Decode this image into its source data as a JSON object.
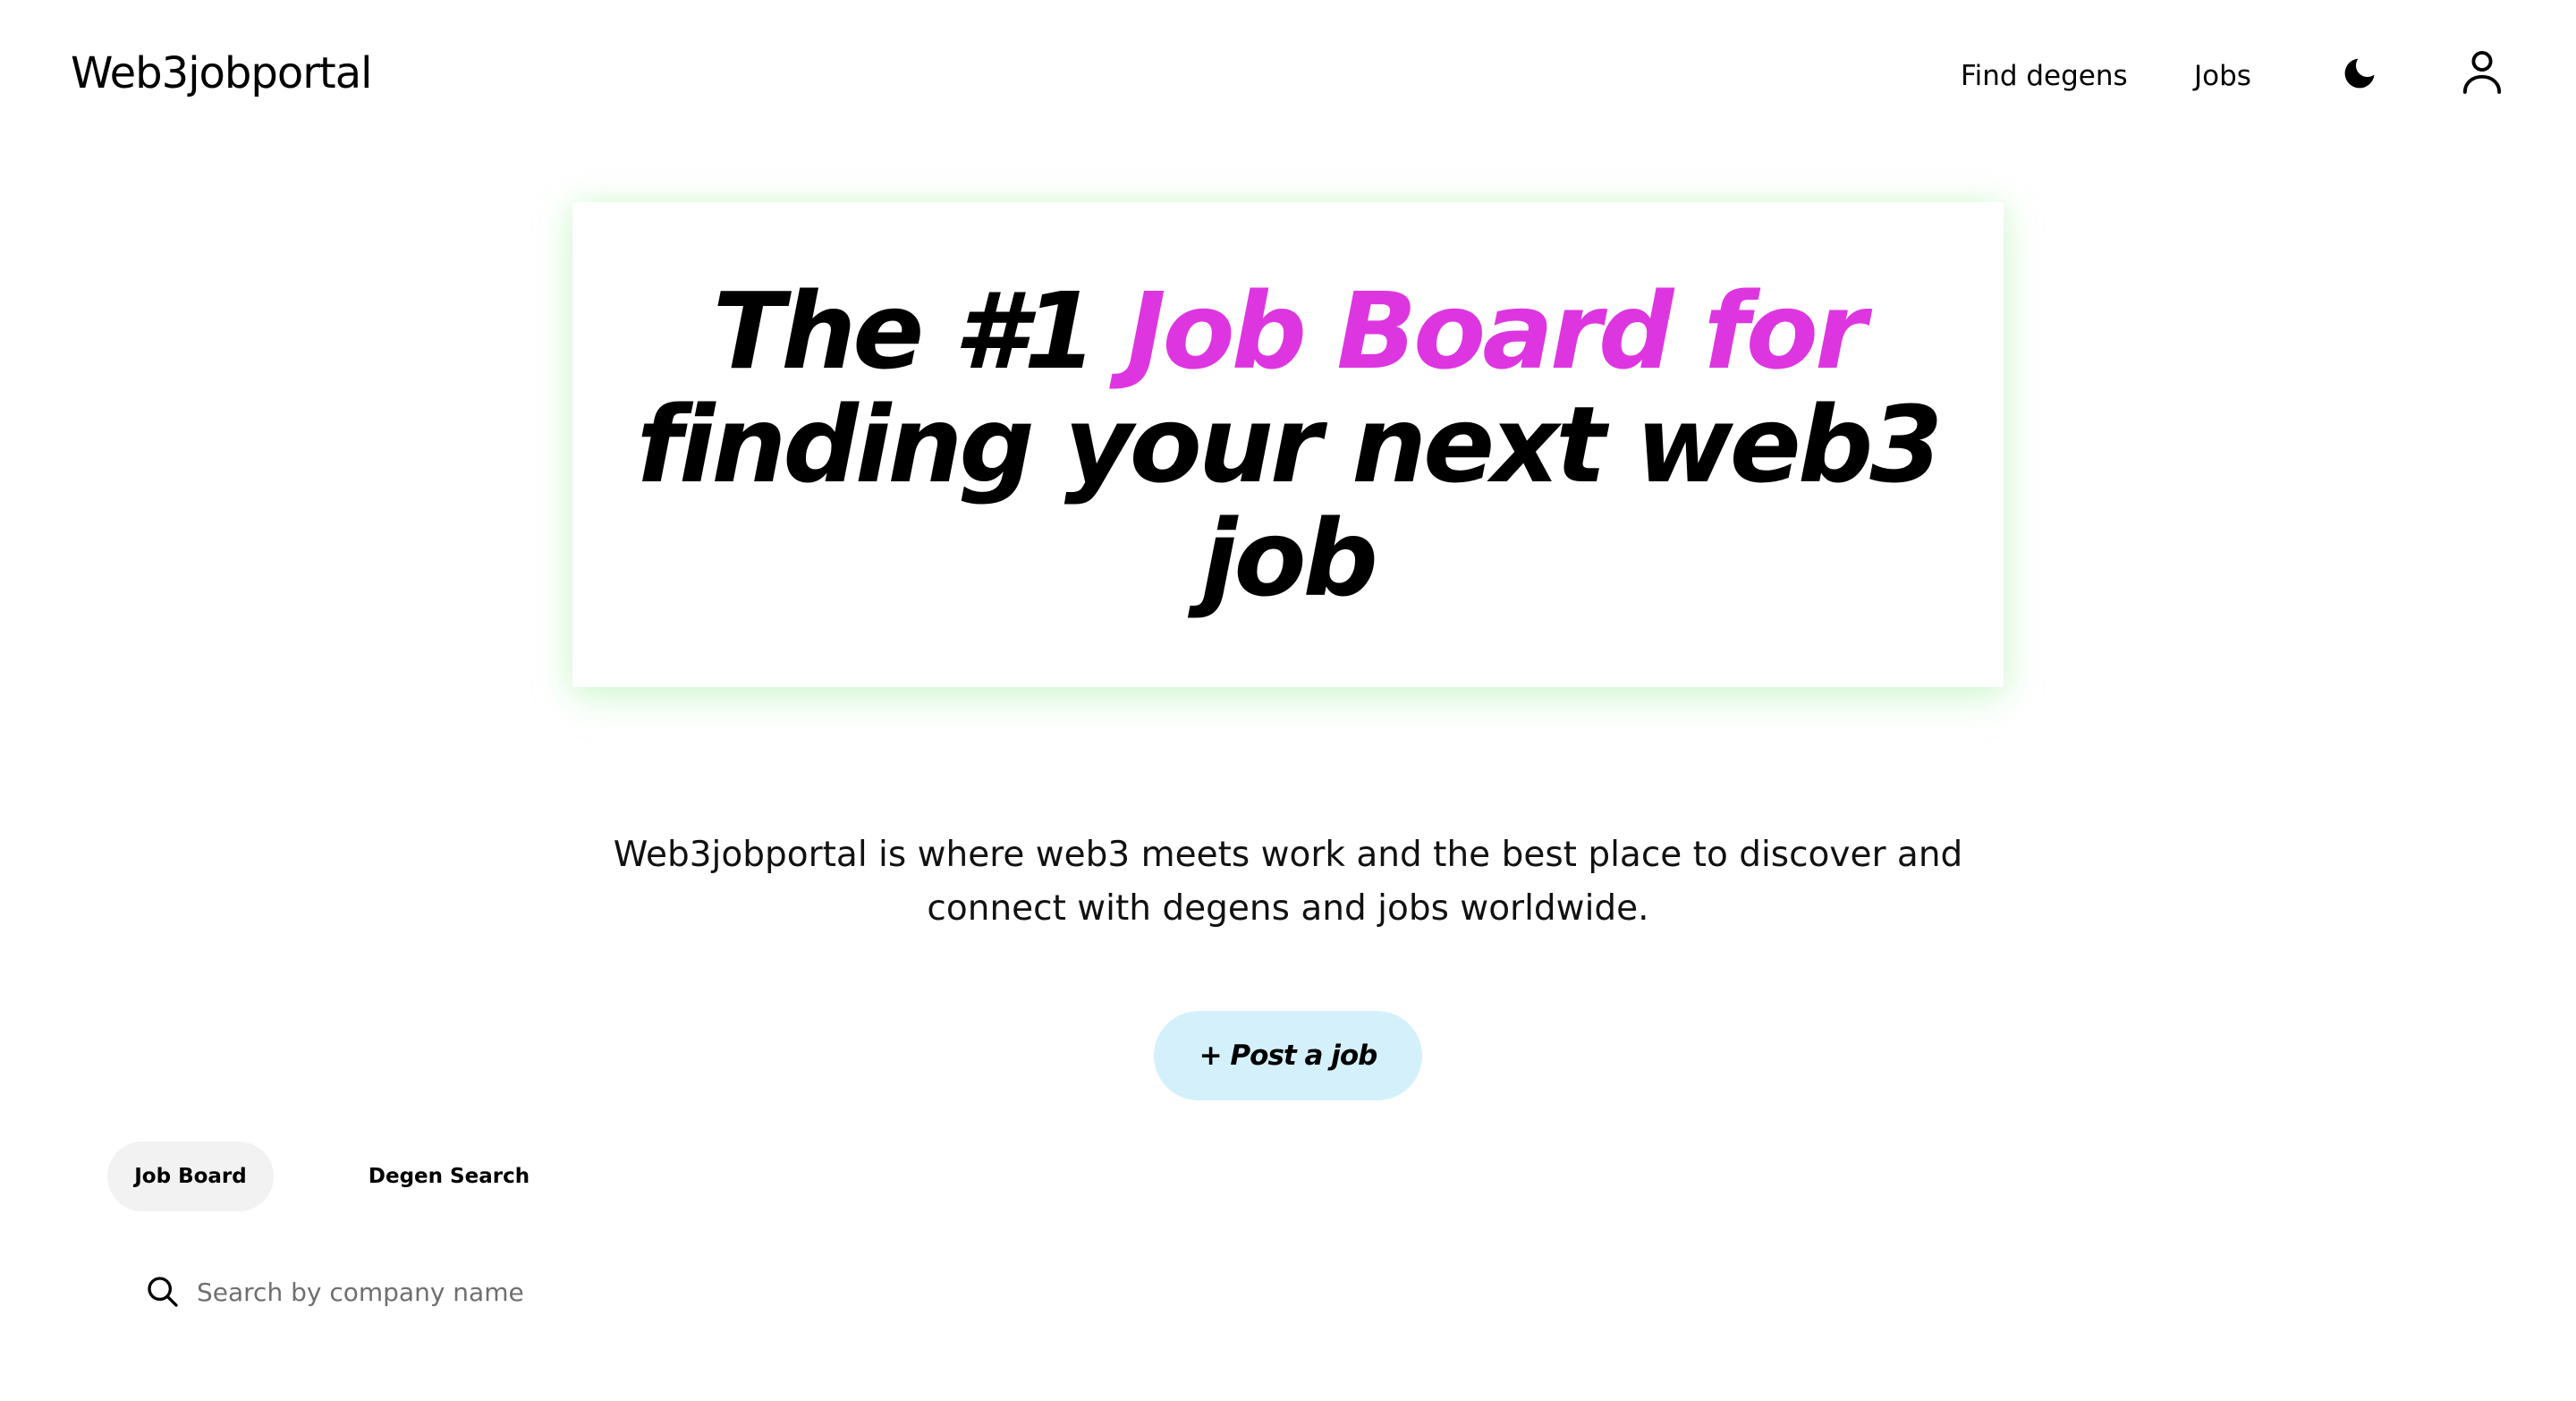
{
  "header": {
    "logo": "Web3jobportal",
    "nav": {
      "find_degens": "Find degens",
      "jobs": "Jobs"
    },
    "icons": {
      "theme_toggle": "moon-icon",
      "account": "user-icon"
    }
  },
  "hero": {
    "title_prefix": "The #1 ",
    "title_accent": "Job Board for",
    "title_rest": "finding your next web3 job",
    "accent_color": "#dd36e0"
  },
  "description": "Web3jobportal is where web3 meets work and the best place to discover and connect with degens and jobs worldwide.",
  "cta": {
    "post_job_label": "+ Post a job",
    "bg_color": "#d4f1fb"
  },
  "tabs": [
    {
      "label": "Job Board",
      "active": true
    },
    {
      "label": "Degen Search",
      "active": false
    }
  ],
  "search": {
    "placeholder": "Search by company name",
    "value": ""
  }
}
